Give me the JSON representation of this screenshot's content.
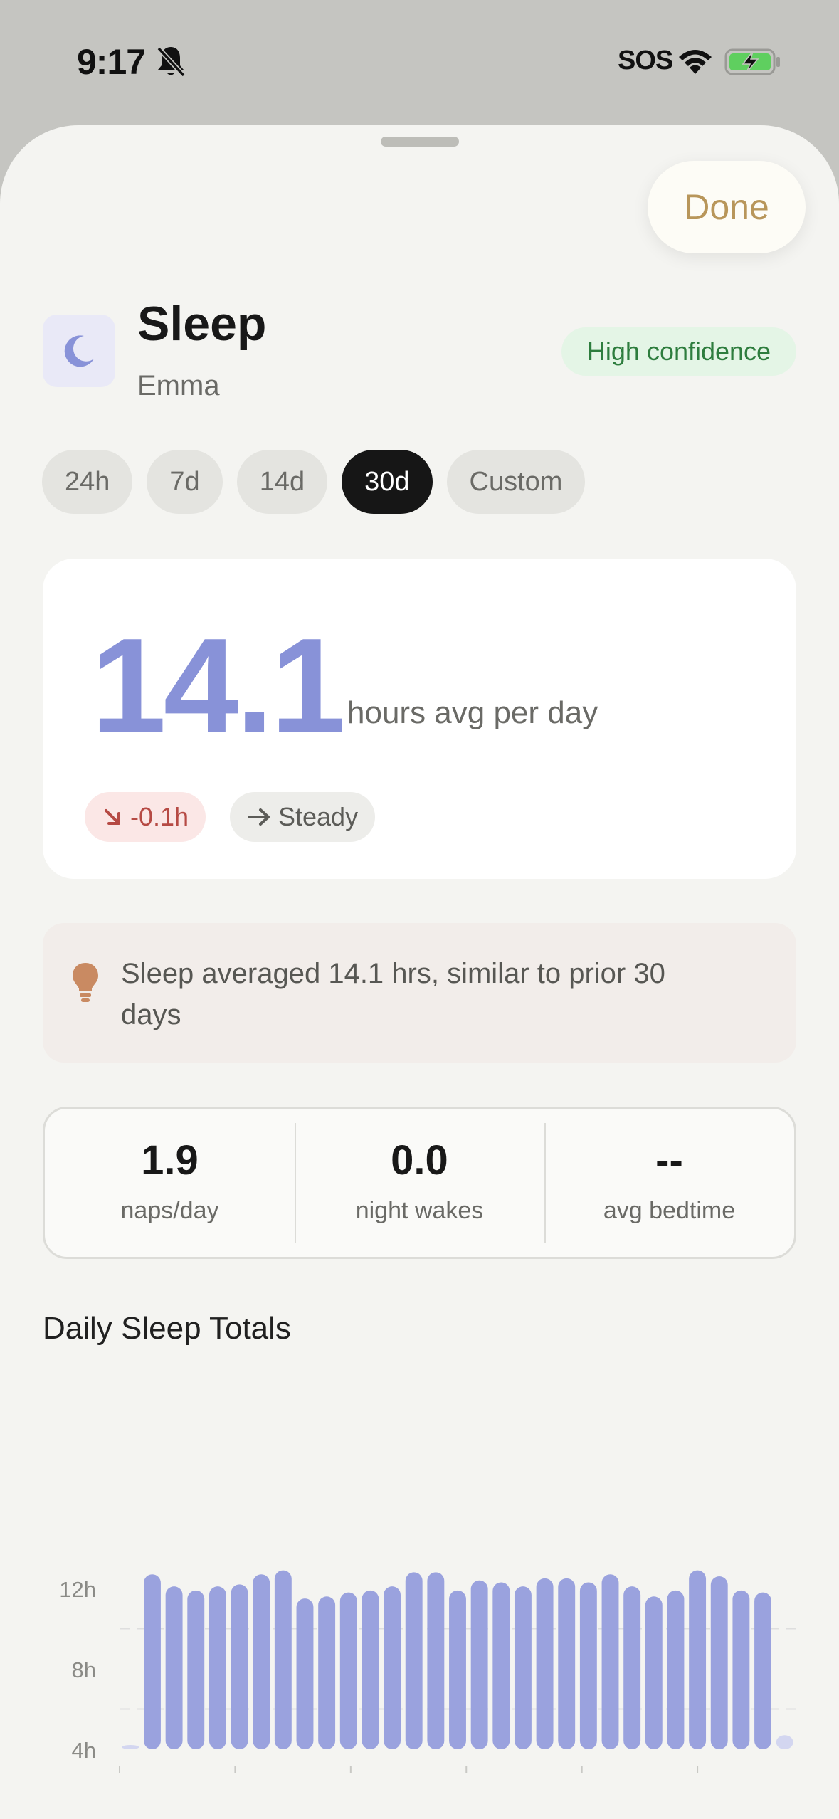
{
  "status_bar": {
    "time": "9:17",
    "carrier": "SOS",
    "icons": [
      "bell-slash-icon",
      "wifi-icon",
      "battery-charging-icon"
    ]
  },
  "header": {
    "done_label": "Done",
    "title": "Sleep",
    "subtitle": "Emma",
    "confidence_badge": "High confidence",
    "icon": "moon-icon"
  },
  "range_tabs": [
    {
      "label": "24h",
      "active": false
    },
    {
      "label": "7d",
      "active": false
    },
    {
      "label": "14d",
      "active": false
    },
    {
      "label": "30d",
      "active": true
    },
    {
      "label": "Custom",
      "active": false
    }
  ],
  "summary": {
    "value": "14.1",
    "unit": "hours avg per day",
    "delta": "-0.1h",
    "trend": "Steady"
  },
  "insight": {
    "icon": "lightbulb-icon",
    "text": "Sleep averaged 14.1 hrs, similar to prior 30 days"
  },
  "stats": [
    {
      "value": "1.9",
      "label": "naps/day"
    },
    {
      "value": "0.0",
      "label": "night wakes"
    },
    {
      "value": "--",
      "label": "avg bedtime"
    }
  ],
  "section_title": "Daily Sleep Totals",
  "colors": {
    "accent": "#8892d8",
    "bar": "#9aa2de",
    "done": "#b8965a",
    "confidence_bg": "#e4f5e6",
    "confidence_fg": "#2e7d3e",
    "delta_bg": "#fbe7e6",
    "delta_fg": "#b64a44"
  },
  "chart_data": {
    "type": "bar",
    "y_ticks": [
      "12h",
      "8h",
      "4h"
    ],
    "y_tick_values": [
      12,
      8,
      4
    ],
    "ylim": [
      4,
      12.5
    ],
    "values": [
      4.1,
      12.7,
      12.1,
      11.9,
      12.1,
      12.2,
      12.7,
      12.9,
      11.5,
      11.6,
      11.8,
      11.9,
      12.1,
      12.8,
      12.8,
      11.9,
      12.4,
      12.3,
      12.1,
      12.5,
      12.5,
      12.3,
      12.7,
      12.1,
      11.6,
      11.9,
      12.9,
      12.6,
      11.9,
      11.8,
      4.7
    ],
    "muted_indices": [
      0,
      30
    ],
    "grid": true
  }
}
